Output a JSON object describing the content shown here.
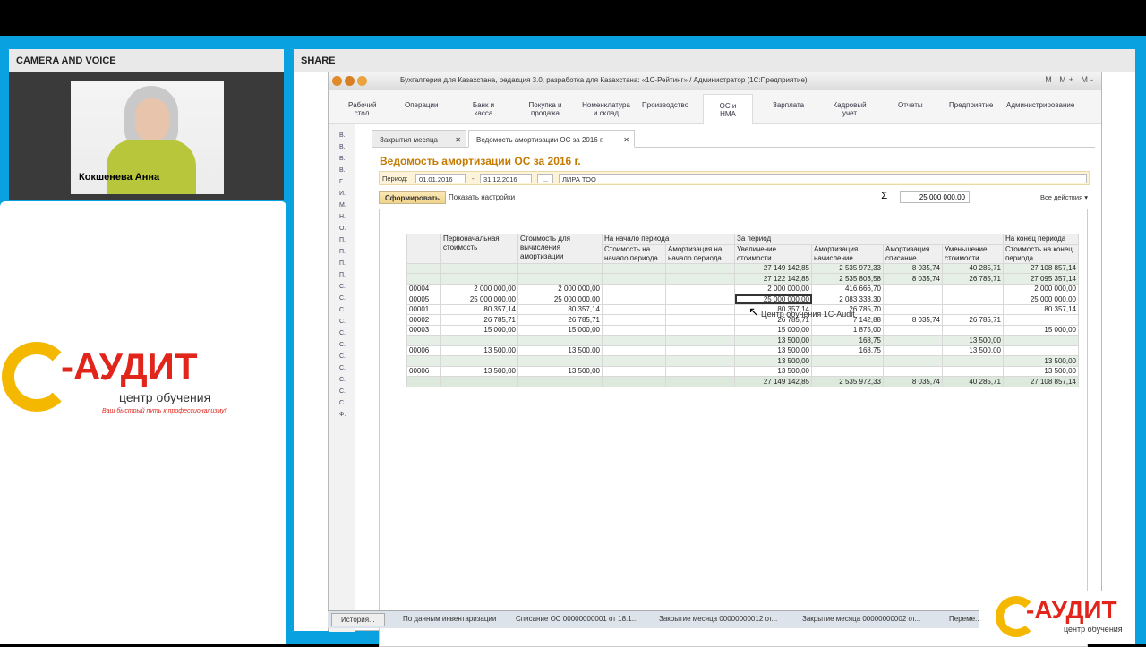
{
  "panels": {
    "camera_title": "CAMERA AND VOICE",
    "share_title": "SHARE"
  },
  "camera": {
    "name": "Кокшенева Анна"
  },
  "logo": {
    "brand": "-АУДИТ",
    "subtitle": "центр обучения",
    "motto": "Ваш быстрый путь к профессионализму!"
  },
  "logo_small": {
    "brand": "-АУДИТ",
    "subtitle": "центр обучения"
  },
  "app": {
    "title": "Бухгалтерия для Казахстана, редакция 3.0, разработка для Казахстана: «1С-Рейтинг» / Администратор  (1С:Предприятие)",
    "titlebar_right": "M M+ M-",
    "menu": [
      "Рабочий стол",
      "Операции",
      "Банк и касса",
      "Покупка и продажа",
      "Номенклатура и склад",
      "Производство",
      "ОС и НМА",
      "Зарплата",
      "Кадровый учет",
      "Отчеты",
      "Предприятие",
      "Администрирование"
    ],
    "left_letters": [
      "В.",
      "В.",
      "В.",
      "В.",
      "Г.",
      "И.",
      "М.",
      "Н.",
      "О.",
      "П.",
      "П.",
      "П.",
      "П.",
      "С.",
      "С.",
      "С.",
      "С.",
      "С.",
      "С.",
      "С.",
      "С.",
      "С.",
      "С.",
      "С.",
      "Ф."
    ],
    "tabs": [
      {
        "label": "Закрытия месяца"
      },
      {
        "label": "Ведомость амортизации ОС  за 2016 г."
      }
    ],
    "doc_title": "Ведомость амортизации ОС  за 2016 г.",
    "period": {
      "label": "Период:",
      "from": "01.01.2016",
      "to": "31.12.2016",
      "org": "ЛИРА ТОО",
      "dash": "-",
      "dots": "..."
    },
    "toolbar": {
      "form_btn": "Сформировать",
      "settings": "Показать настройки",
      "sum": "25 000 000,00",
      "all_actions": "Все действия ▾"
    },
    "table": {
      "group_headers": [
        "На начало периода",
        "За период",
        "На конец периода"
      ],
      "columns": [
        "Первоначальная стоимость",
        "Стоимость для вычисления амортизации",
        "Стоимость на начало периода",
        "Амортизация на начало периода",
        "Увеличение стоимости",
        "Амортизация начисление",
        "Амортизация списание",
        "Уменьшение стоимости",
        "Стоимость на конец периода"
      ],
      "rows": [
        {
          "code": "",
          "v": [
            "",
            "",
            "",
            "",
            "27 149 142,85",
            "2 535 972,33",
            "8 035,74",
            "40 285,71",
            "27 108 857,14"
          ],
          "type": "grp"
        },
        {
          "code": "",
          "v": [
            "",
            "",
            "",
            "",
            "27 122 142,85",
            "2 535 803,58",
            "8 035,74",
            "26 785,71",
            "27 095 357,14"
          ],
          "type": "grp"
        },
        {
          "code": "00004",
          "v": [
            "2 000 000,00",
            "2 000 000,00",
            "",
            "",
            "2 000 000,00",
            "416 666,70",
            "",
            "",
            "2 000 000,00"
          ],
          "type": ""
        },
        {
          "code": "00005",
          "v": [
            "25 000 000,00",
            "25 000 000,00",
            "",
            "",
            "25 000 000,00",
            "2 083 333,30",
            "",
            "",
            "25 000 000,00"
          ],
          "type": "sel"
        },
        {
          "code": "00001",
          "v": [
            "80 357,14",
            "80 357,14",
            "",
            "",
            "80 357,14",
            "26 785,70",
            "",
            "",
            "80 357,14"
          ],
          "type": ""
        },
        {
          "code": "00002",
          "v": [
            "26 785,71",
            "26 785,71",
            "",
            "",
            "26 785,71",
            "7 142,88",
            "8 035,74",
            "26 785,71",
            ""
          ],
          "type": ""
        },
        {
          "code": "00003",
          "v": [
            "15 000,00",
            "15 000,00",
            "",
            "",
            "15 000,00",
            "1 875,00",
            "",
            "",
            "15 000,00"
          ],
          "type": ""
        },
        {
          "code": "",
          "v": [
            "",
            "",
            "",
            "",
            "13 500,00",
            "168,75",
            "",
            "13 500,00",
            ""
          ],
          "type": "grp"
        },
        {
          "code": "00006",
          "v": [
            "13 500,00",
            "13 500,00",
            "",
            "",
            "13 500,00",
            "168,75",
            "",
            "13 500,00",
            ""
          ],
          "type": ""
        },
        {
          "code": "",
          "v": [
            "",
            "",
            "",
            "",
            "13 500,00",
            "",
            "",
            "",
            "13 500,00"
          ],
          "type": "grp"
        },
        {
          "code": "00006",
          "v": [
            "13 500,00",
            "13 500,00",
            "",
            "",
            "13 500,00",
            "",
            "",
            "",
            "13 500,00"
          ],
          "type": ""
        },
        {
          "code": "",
          "v": [
            "",
            "",
            "",
            "",
            "27 149 142,85",
            "2 535 972,33",
            "8 035,74",
            "40 285,71",
            "27 108 857,14"
          ],
          "type": "tot"
        }
      ]
    },
    "tooltip": "Центр обучения 1С-Audit",
    "taskbar": [
      "История...",
      "По данным инвентаризации",
      "Списание ОС 00000000001 от 18.1...",
      "Закрытие месяца 00000000012 от...",
      "Закрытие месяца 00000000002 от...",
      "Переме..."
    ]
  }
}
